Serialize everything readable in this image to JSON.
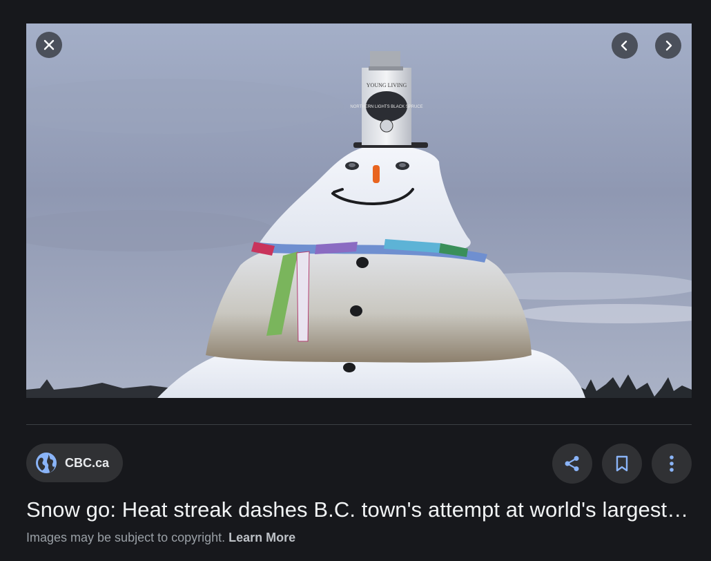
{
  "viewer": {
    "source": {
      "name": "CBC.ca",
      "icon": "globe-icon"
    },
    "title": "Snow go: Heat streak dashes B.C. town's attempt at world's largest snowman",
    "copyright_text": "Images may be subject to copyright.",
    "learn_more": "Learn More",
    "image": {
      "chimney_label_top": "YOUNG LIVING",
      "chimney_label_main": "NORTHERN LIGHTS BLACK SPRUCE"
    },
    "controls": {
      "close_icon": "close-icon",
      "prev_icon": "chevron-left-icon",
      "next_icon": "chevron-right-icon",
      "share_icon": "share-icon",
      "save_icon": "bookmark-icon",
      "more_icon": "more-vert-icon"
    },
    "colors": {
      "background": "#17181c",
      "chip": "#303134",
      "accent": "#8ab4f8"
    }
  }
}
